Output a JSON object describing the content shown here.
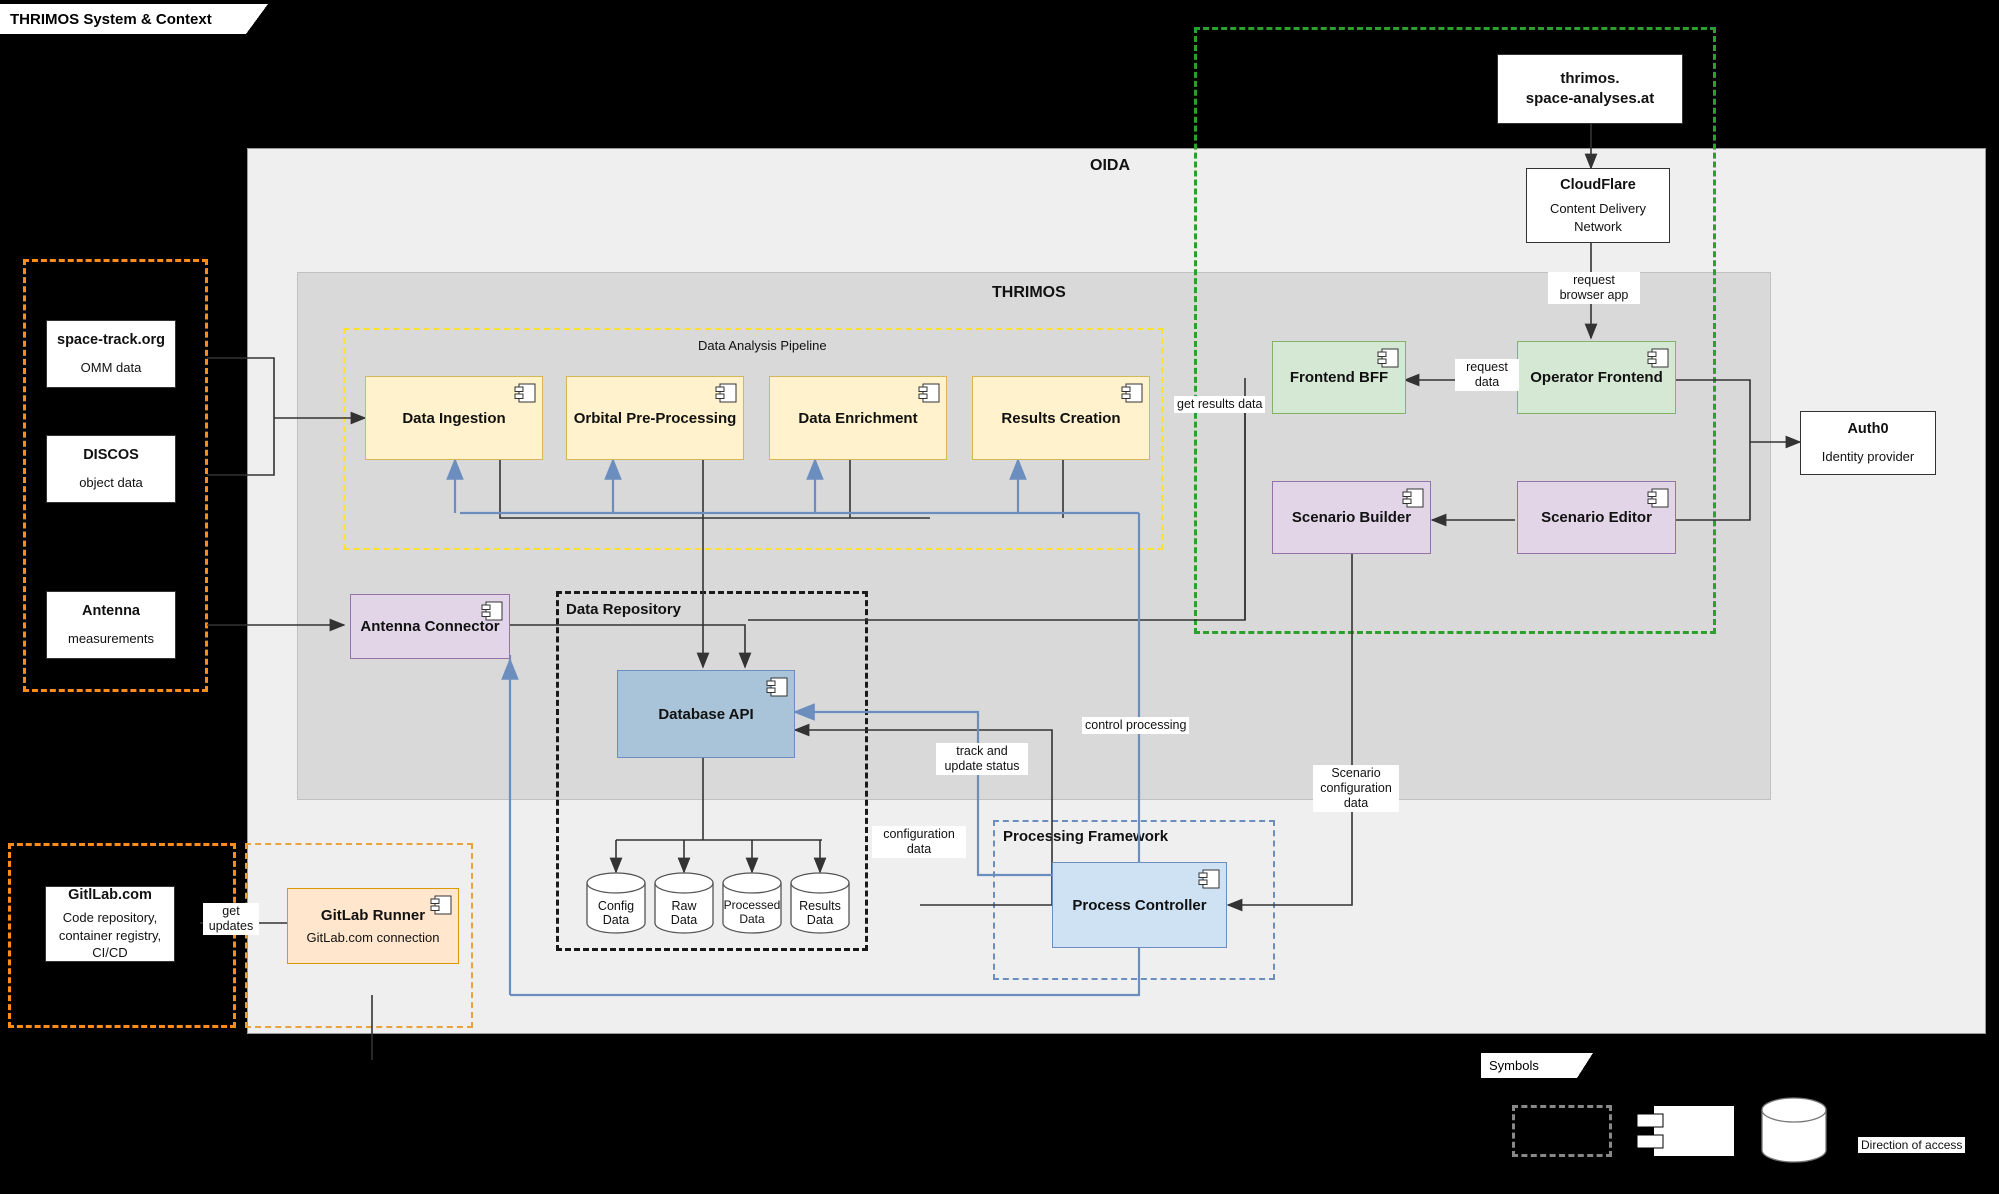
{
  "title_tag": {
    "label": "THRIMOS System & Context"
  },
  "zones": {
    "oida": {
      "label": "OIDA"
    },
    "thrimos": {
      "label": "THRIMOS"
    }
  },
  "boundaries": {
    "data_sources": {
      "label": "",
      "color": "#ff8c1a"
    },
    "gitlab_external": {
      "label": "",
      "color": "#ff8c1a"
    },
    "gitlab_runner_zone": {
      "label": "",
      "color": "#e8a33d"
    },
    "data_analysis_pipeline": {
      "label": "Data Analysis Pipeline",
      "color": "#ffe02e"
    },
    "data_repository": {
      "label": "Data Repository",
      "color": "#1a1a1a"
    },
    "processing_framework": {
      "label": "Processing Framework",
      "color": "#6c8ebf"
    },
    "web_zone": {
      "label": "",
      "color": "#2ca02c"
    }
  },
  "external_systems": [
    {
      "name": "space-track.org",
      "desc": "OMM data"
    },
    {
      "name": "DISCOS",
      "desc": "object data"
    },
    {
      "name": "Antenna",
      "desc": "measurements"
    },
    {
      "name": "GitlLab.com",
      "desc": "Code repository,\ncontainer registry,\nCI/CD"
    },
    {
      "name": "thrimos.\nspace-analyses.at",
      "desc": ""
    },
    {
      "name": "CloudFlare",
      "desc": "Content Delivery\nNetwork"
    },
    {
      "name": "Auth0",
      "desc": "Identity provider"
    }
  ],
  "components": {
    "data_ingestion": {
      "label": "Data Ingestion",
      "sub": "",
      "color": "#fff2cc"
    },
    "orbital_pre_processing": {
      "label": "Orbital Pre-Processing",
      "sub": "",
      "color": "#fff2cc"
    },
    "data_enrichment": {
      "label": "Data Enrichment",
      "sub": "",
      "color": "#fff2cc"
    },
    "results_creation": {
      "label": "Results Creation",
      "sub": "",
      "color": "#fff2cc"
    },
    "antenna_connector": {
      "label": "Antenna Connector",
      "sub": "",
      "color": "#e1d5e7"
    },
    "database_api": {
      "label": "Database API",
      "sub": "",
      "color": "#a9c4d8"
    },
    "process_controller": {
      "label": "Process Controller",
      "sub": "",
      "color": "#cfe2f3"
    },
    "frontend_bff": {
      "label": "Frontend BFF",
      "sub": "",
      "color": "#d5e8d4"
    },
    "operator_frontend": {
      "label": "Operator Frontend",
      "sub": "",
      "color": "#d5e8d4"
    },
    "scenario_builder": {
      "label": "Scenario Builder",
      "sub": "",
      "color": "#e1d5e7"
    },
    "scenario_editor": {
      "label": "Scenario Editor",
      "sub": "",
      "color": "#e1d5e7"
    },
    "gitlab_runner": {
      "label": "GitLab Runner",
      "sub": "GitLab.com connection",
      "color": "#ffe6cc"
    }
  },
  "datastores": [
    {
      "label": "Config\nData"
    },
    {
      "label": "Raw\nData"
    },
    {
      "label": "Processed\nData"
    },
    {
      "label": "Results\nData"
    }
  ],
  "edge_labels": {
    "get_updates": "get\nupdates",
    "request_browser_app": "request\nbrowser app",
    "request_data": "request\ndata",
    "get_results_data": "get results data",
    "control_processing": "control processing",
    "track_and_update_status": "track and\nupdate status",
    "configuration_data": "configuration\ndata",
    "scenario_configuration_data": "Scenario\nconfiguration\ndata"
  },
  "legend": {
    "tag_label": "Symbols",
    "direction_of_access": "Direction of access",
    "items": [
      "boundary-dashed-rectangle",
      "uml-component",
      "datastore-cylinder",
      "arrow-direction"
    ]
  },
  "colors": {
    "oida_bg": "#efefef",
    "thrimos_bg": "#d9d9d9",
    "wire_black": "#333333",
    "wire_blue": "#6c8ebf",
    "page_bg": "#000000"
  }
}
